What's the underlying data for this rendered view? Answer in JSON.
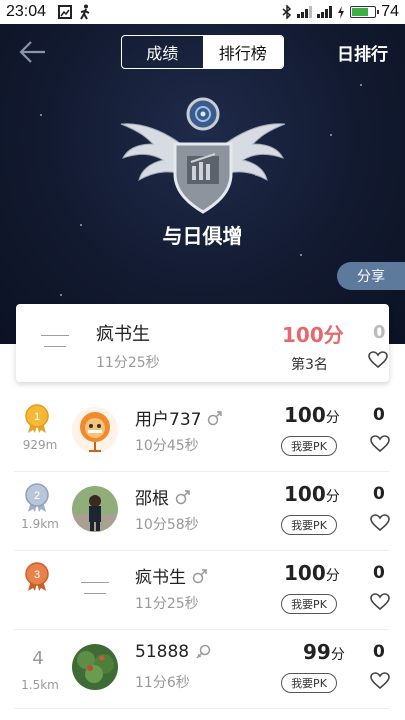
{
  "status_bar": {
    "time": "23:04",
    "battery_percent": "74",
    "battery_level": 0.74,
    "battery_color": "#3cb043",
    "left_icons": [
      "image-notification-icon",
      "walking-icon"
    ],
    "right_icons": [
      "bluetooth-icon",
      "signal-3g-icon",
      "signal-4g-icon",
      "charging-icon"
    ]
  },
  "header": {
    "tabs": [
      {
        "label": "成绩",
        "active": false
      },
      {
        "label": "排行榜",
        "active": true
      }
    ],
    "daily_rank_label": "日排行",
    "back_icon": "arrow-left-icon"
  },
  "hero": {
    "badge_title": "与日俱增",
    "share_label": "分享",
    "badge_icon": "winged-shield-badge-icon",
    "background_color": "#121a30"
  },
  "my_entry": {
    "name": "疯书生",
    "time": "11分25秒",
    "score": "100分",
    "rank": "第3名",
    "likes": "0",
    "score_color": "#e8676b"
  },
  "rankings": [
    {
      "rank": "",
      "medal": "gold",
      "distance": "929m",
      "name": "用户737",
      "gender": "male",
      "time": "10分45秒",
      "score": "100",
      "unit": "分",
      "pk_label": "我要PK",
      "likes": "0",
      "avatar": "orange-lion-avatar"
    },
    {
      "rank": "",
      "medal": "silver",
      "distance": "1.9km",
      "name": "邵根",
      "gender": "male",
      "time": "10分58秒",
      "score": "100",
      "unit": "分",
      "pk_label": "我要PK",
      "likes": "0",
      "avatar": "photo-avatar"
    },
    {
      "rank": "",
      "medal": "bronze",
      "distance": "",
      "name": "疯书生",
      "gender": "male",
      "time": "11分25秒",
      "score": "100",
      "unit": "分",
      "pk_label": "我要PK",
      "likes": "0",
      "avatar": "text-logo-avatar"
    },
    {
      "rank": "4",
      "medal": "",
      "distance": "1.5km",
      "name": "51888",
      "gender": "female",
      "time": "11分6秒",
      "score": "99",
      "unit": "分",
      "pk_label": "我要PK",
      "likes": "0",
      "avatar": "plant-photo-avatar"
    }
  ]
}
